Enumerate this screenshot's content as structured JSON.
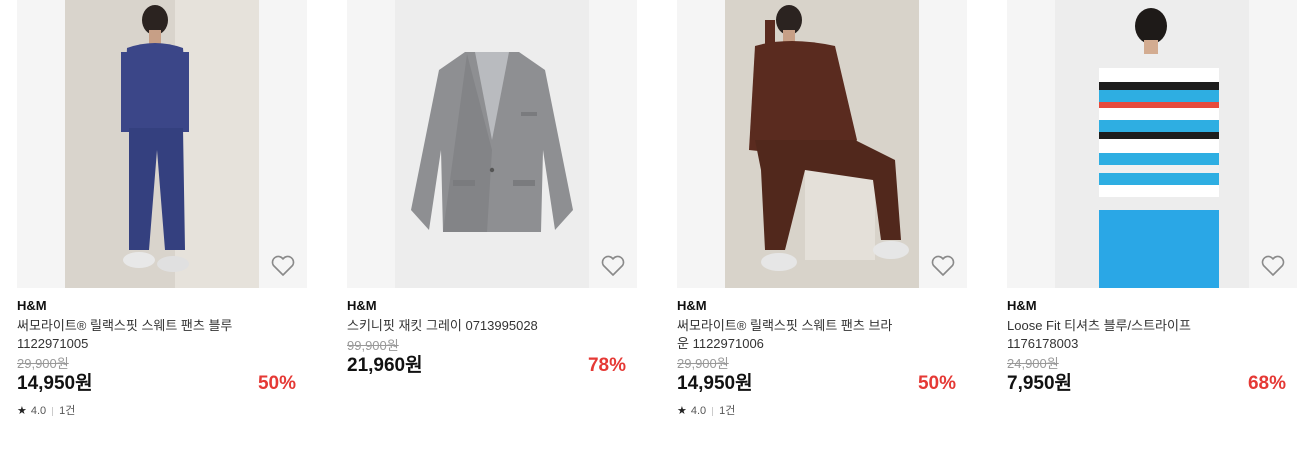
{
  "products": [
    {
      "brand": "H&M",
      "name": "써모라이트® 릴랙스핏 스웨트 팬츠 블루 1122971005",
      "original_price": "29,900원",
      "price": "14,950원",
      "discount": "50%",
      "rating": "4.0",
      "reviews": "1건",
      "image": "model-blue-sweatsuit",
      "favorite_icon": "heart-outline-icon"
    },
    {
      "brand": "H&M",
      "name": "스키니핏 재킷 그레이 0713995028",
      "original_price": "99,900원",
      "price": "21,960원",
      "discount": "78%",
      "rating": "",
      "reviews": "",
      "image": "grey-blazer",
      "favorite_icon": "heart-outline-icon"
    },
    {
      "brand": "H&M",
      "name": "써모라이트® 릴랙스핏 스웨트 팬츠 브라운 1122971006",
      "original_price": "29,900원",
      "price": "14,950원",
      "discount": "50%",
      "rating": "4.0",
      "reviews": "1건",
      "image": "model-brown-sweatsuit",
      "favorite_icon": "heart-outline-icon"
    },
    {
      "brand": "H&M",
      "name": "Loose Fit 티셔츠 블루/스트라이프 1176178003",
      "original_price": "24,900원",
      "price": "7,950원",
      "discount": "68%",
      "rating": "",
      "reviews": "",
      "image": "model-striped-tshirt",
      "favorite_icon": "heart-outline-icon"
    }
  ],
  "colors": {
    "discount": "#e53935",
    "thumb_background": "#f5f5f5"
  }
}
